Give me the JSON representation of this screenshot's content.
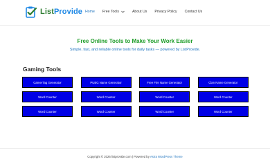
{
  "header": {
    "logo_text_a": "List",
    "logo_text_b": "Provide",
    "nav": {
      "home": "Home",
      "free_tools": "Free Tools",
      "about": "About Us",
      "privacy": "Privacy Policy",
      "contact": "Contact Us"
    }
  },
  "hero": {
    "title": "Free Online Tools to Make Your Work Easier",
    "subtitle": "Simple, fast, and reliable online tools for daily tasks — powered by ListProvide."
  },
  "section": {
    "title": "Gaming Tools"
  },
  "tools": [
    "GamerTag Generator",
    "PUBG Name Generator",
    "Free Fire Name Generator",
    "Clan Name Generator",
    "Word Counter",
    "Word Counter",
    "Word Counter",
    "Word Counter",
    "Word Counter",
    "Word Counter",
    "Word Counter",
    "Word Counter"
  ],
  "footer": {
    "prefix": "Copyright © 2026 listprovide.com | Powered by ",
    "theme_link": "Astra WordPress Theme"
  },
  "colors": {
    "brand_green": "#2e7d32",
    "brand_blue": "#1e88e5",
    "button_blue": "#0000e6",
    "hero_green": "#1f9d2a"
  }
}
